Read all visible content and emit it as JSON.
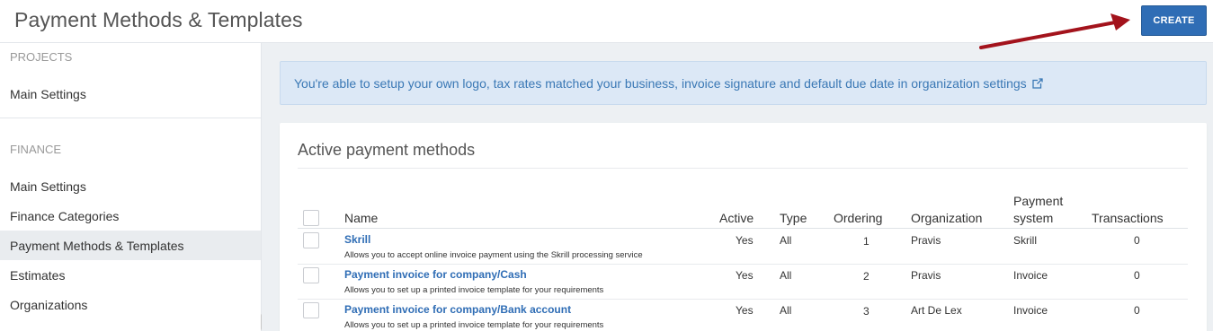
{
  "header": {
    "title": "Payment Methods & Templates",
    "create_label": "CREATE"
  },
  "sidebar": {
    "sections": [
      {
        "title": "PROJECTS",
        "items": [
          {
            "label": "Main Settings"
          }
        ]
      },
      {
        "title": "FINANCE",
        "items": [
          {
            "label": "Main Settings"
          },
          {
            "label": "Finance Categories"
          },
          {
            "label": "Payment Methods & Templates",
            "active": true
          },
          {
            "label": "Estimates"
          },
          {
            "label": "Organizations"
          }
        ]
      }
    ]
  },
  "info": {
    "text": "You're able to setup your own logo, tax rates matched your business, invoice signature and default due date in organization settings",
    "icon": "external-link-icon"
  },
  "table": {
    "title": "Active payment methods",
    "columns": {
      "name": "Name",
      "active": "Active",
      "type": "Type",
      "ordering": "Ordering",
      "organization": "Organization",
      "payment_system_1": "Payment",
      "payment_system_2": "system",
      "transactions": "Transactions"
    },
    "rows": [
      {
        "name": "Skrill",
        "description": "Allows you to accept online invoice payment using the Skrill processing service",
        "active": "Yes",
        "type": "All",
        "ordering": "1",
        "organization": "Pravis",
        "payment_system": "Skrill",
        "transactions": "0"
      },
      {
        "name": "Payment invoice for company/Cash",
        "description": "Allows you to set up a printed invoice template for your requirements",
        "active": "Yes",
        "type": "All",
        "ordering": "2",
        "organization": "Pravis",
        "payment_system": "Invoice",
        "transactions": "0"
      },
      {
        "name": "Payment invoice for company/Bank account",
        "description": "Allows you to set up a printed invoice template for your requirements",
        "active": "Yes",
        "type": "All",
        "ordering": "3",
        "organization": "Art De Lex",
        "payment_system": "Invoice",
        "transactions": "0"
      }
    ]
  },
  "colors": {
    "accent": "#2f6db5",
    "info_bg": "#dce8f6",
    "info_text": "#3a78b5",
    "arrow": "#a3131c"
  }
}
